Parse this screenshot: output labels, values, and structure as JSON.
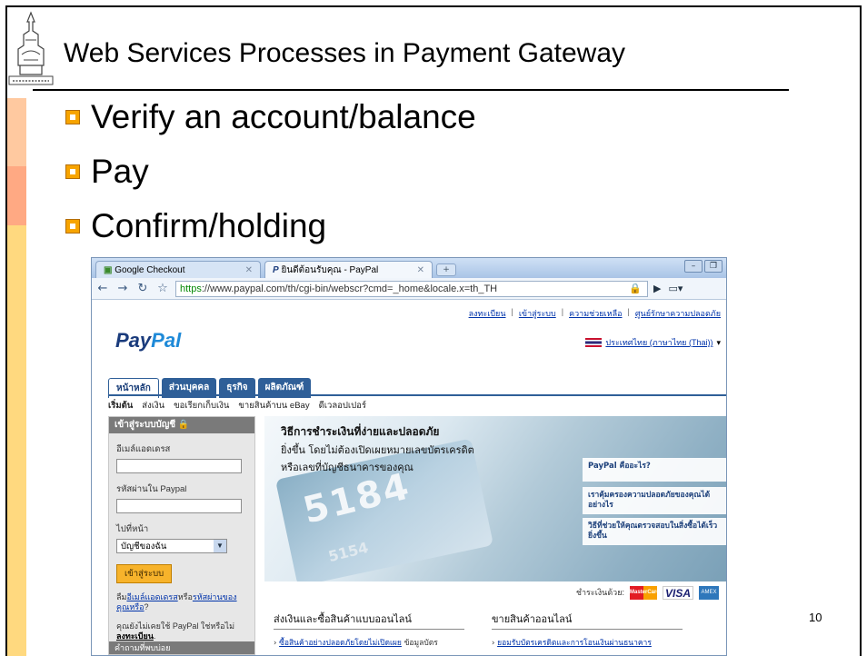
{
  "slide": {
    "title": "Web Services Processes in Payment Gateway",
    "bullets": [
      "Verify an account/balance",
      "Pay",
      "Confirm/holding"
    ],
    "page_number": "10",
    "accent_color": "#f7a400"
  },
  "browser": {
    "tabs": [
      {
        "label": "Google Checkout",
        "icon": "google-checkout-icon"
      },
      {
        "label": "ยินดีต้อนรับคุณ - PayPal",
        "icon": "paypal-icon"
      }
    ],
    "address": {
      "scheme": "https",
      "rest": "://www.paypal.com/th/cgi-bin/webscr?cmd=_home&locale.x=th_TH"
    }
  },
  "paypal": {
    "logo_main": "Pay",
    "logo_pal": "Pal",
    "top_links": [
      "ลงทะเบียน",
      "เข้าสู่ระบบ",
      "ความช่วยเหลือ",
      "ศูนย์รักษาความปลอดภัย"
    ],
    "language": "ประเทศไทย (ภาษาไทย (Thai))",
    "main_tabs": [
      "หน้าหลัก",
      "ส่วนบุคคล",
      "ธุรกิจ",
      "ผลิตภัณฑ์"
    ],
    "sub_nav": [
      "เริ่มต้น",
      "ส่งเงิน",
      "ขอเรียกเก็บเงิน",
      "ขายสินค้าบน eBay",
      "ดีเวลอปเปอร์"
    ],
    "login": {
      "heading": "เข้าสู่ระบบบัญชี",
      "email_label": "อีเมล์แอดเดรส",
      "password_label": "รหัสผ่านใน Paypal",
      "goto_label": "ไปที่หน้า",
      "goto_value": "บัญชีของฉัน",
      "submit": "เข้าสู่ระบบ",
      "forgot_prefix": "ลืม",
      "forgot_email": "อีเมล์แอดเดรส",
      "forgot_or": "หรือ",
      "forgot_password": "รหัสผ่านของคุณหรือ",
      "forgot_suffix": "?",
      "notuser_text": "คุณยังไม่เคยใช้ PayPal ใช่หรือไม่",
      "register": "ลงทะเบียน",
      "faq": "คำถามที่พบบ่อย"
    },
    "banner": {
      "heading": "วิธีการชำระเงินที่ง่ายและปลอดภัย",
      "line1": "ยิ่งขึ้น โดยไม่ต้องเปิดเผยหมายเลขบัตรเครดิต",
      "line2": "หรือเลขที่บัญชีธนาคารของคุณ",
      "card_number": "5184",
      "card_number_small": "5154",
      "side_links": [
        "PayPal คืออะไร?",
        "เราคุ้มครองความปลอดภัยของคุณได้อย่างไร",
        "วิธีที่ช่วยให้คุณตรวจสอบในสิ่งซื้อได้เร็วยิ่งขึ้น"
      ]
    },
    "pay_with": "ชำระเงินด้วย:",
    "cards": [
      "MasterCard",
      "VISA",
      "AMEX"
    ],
    "columns": [
      {
        "heading": "ส่งเงินและซื้อสินค้าแบบออนไลน์",
        "link": "ซื้อสินค้าอย่างปลอดภัยโดยไม่เปิดเผย",
        "text": "ข้อมูลบัตร"
      },
      {
        "heading": "ขายสินค้าออนไลน์",
        "link": "ยอมรับบัตรเครดิตและการโอนเงินผ่านธนาคาร",
        "text": ""
      }
    ]
  }
}
